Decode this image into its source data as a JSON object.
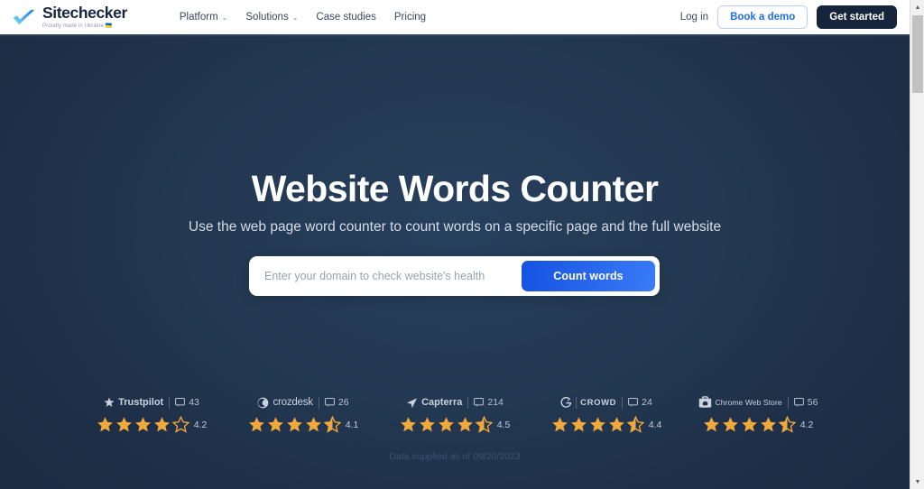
{
  "header": {
    "logo": {
      "name": "Sitechecker",
      "tagline": "Proudly made in Ukraine 🇺🇦",
      "icon": "blue-check-logo-icon"
    },
    "nav": [
      {
        "label": "Platform",
        "has_dropdown": true,
        "chevron": "⌄"
      },
      {
        "label": "Solutions",
        "has_dropdown": true,
        "chevron": "⌄"
      },
      {
        "label": "Case studies",
        "has_dropdown": false
      },
      {
        "label": "Pricing",
        "has_dropdown": false
      }
    ],
    "login_label": "Log in",
    "demo_label": "Book a demo",
    "get_started_label": "Get started"
  },
  "hero": {
    "title": "Website Words Counter",
    "subtitle": "Use the web page word counter to count words on a specific page and the full website",
    "search": {
      "placeholder": "Enter your domain to check website's health",
      "value": "",
      "button_label": "Count words"
    }
  },
  "reviews": {
    "items": [
      {
        "brand": "Trustpilot",
        "brand_icon": "trustpilot-star-icon",
        "count": "43",
        "rating": "4.2",
        "full_stars": 4,
        "half_star": false,
        "empty_stars": 1
      },
      {
        "brand": "crozdesk",
        "brand_icon": "crozdesk-icon",
        "count": "26",
        "rating": "4.1",
        "full_stars": 4,
        "half_star": true,
        "empty_stars": 0
      },
      {
        "brand": "Capterra",
        "brand_icon": "capterra-arrow-icon",
        "count": "214",
        "rating": "4.5",
        "full_stars": 4,
        "half_star": true,
        "empty_stars": 0
      },
      {
        "brand": "CROWD",
        "brand_icon": "g2-crowd-icon",
        "count": "24",
        "rating": "4.4",
        "full_stars": 4,
        "half_star": true,
        "empty_stars": 0
      },
      {
        "brand": "Chrome Web Store",
        "brand_icon": "chrome-web-store-icon",
        "count": "56",
        "rating": "4.2",
        "full_stars": 4,
        "half_star": true,
        "empty_stars": 0
      }
    ],
    "data_note": "Data supplied as of 09/20/2023"
  },
  "colors": {
    "hero_bg": "#1c2d45",
    "hero_bg_center": "#27405d",
    "accent_blue": "#1f6fe5",
    "cta_gradient_start": "#1552e0",
    "cta_gradient_end": "#3a7bf7",
    "dark_button": "#16243c",
    "star_gold": "#f2a93b",
    "heading_white": "#ffffff"
  },
  "scrollbar": {
    "up_arrow": "▲",
    "down_arrow": "▼"
  }
}
